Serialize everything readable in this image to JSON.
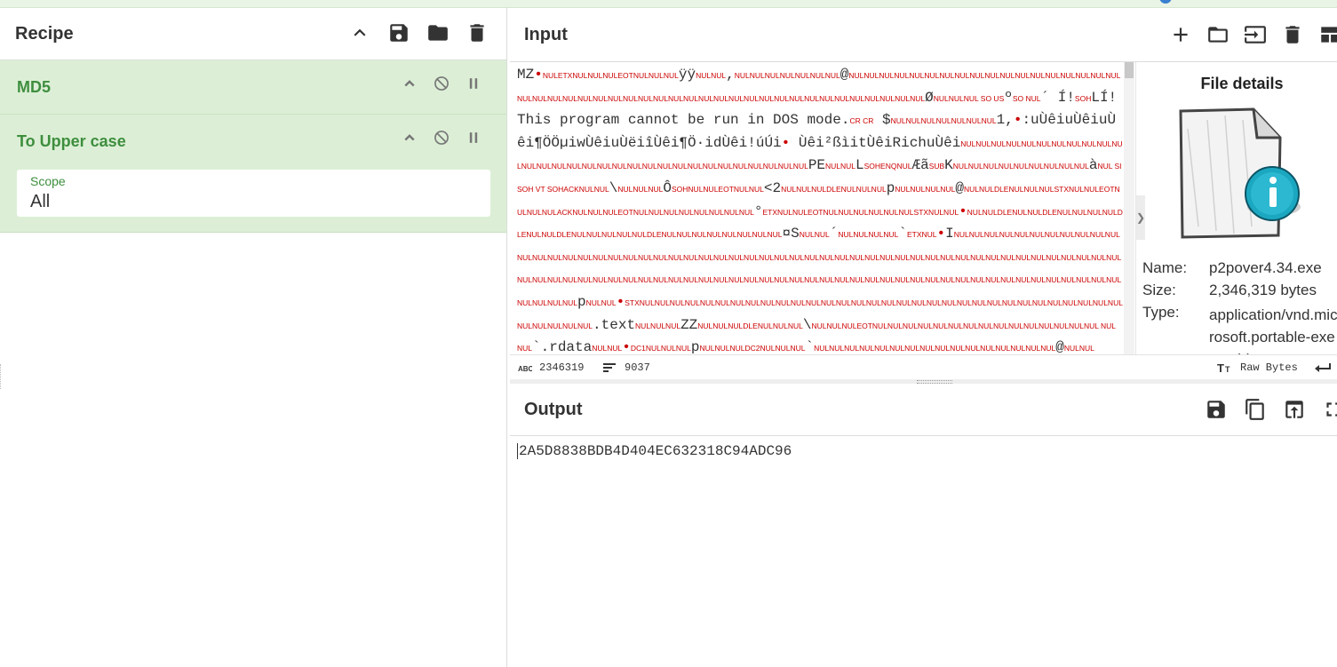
{
  "recipe": {
    "title": "Recipe",
    "operations": [
      {
        "name": "MD5"
      },
      {
        "name": "To Upper case",
        "scope_label": "Scope",
        "scope_value": "All"
      }
    ]
  },
  "input": {
    "title": "Input",
    "content_segments": [
      [
        "t",
        "MZ"
      ],
      [
        "d",
        "•"
      ],
      [
        "c",
        "NULETXNULNULNULEOTNULNULNUL"
      ],
      [
        "t",
        "ÿÿ"
      ],
      [
        "c",
        "NULNUL"
      ],
      [
        "t",
        ","
      ],
      [
        "c",
        "NULNULNULNULNULNULNUL"
      ],
      [
        "t",
        "@"
      ],
      [
        "c",
        "NULNULNULNULNULNULNULNULNULNULNULNULNULNULNULNULNULNULNULNULNULNULNULNULNULNULNULNULNULNULNULNULNULNULNULNULNULNULNULNULNULNULNULNULNUL"
      ],
      [
        "t",
        "Ø"
      ],
      [
        "c",
        "NULNULNUL SO US"
      ],
      [
        "t",
        "º"
      ],
      [
        "c",
        "SO NUL"
      ],
      [
        "t",
        "´   Í!"
      ],
      [
        "c",
        "SOH"
      ],
      [
        "t",
        "LÍ!This program cannot be run in DOS mode."
      ],
      [
        "c",
        "CR CR"
      ],
      [
        "t",
        " $"
      ],
      [
        "c",
        "NULNULNULNULNULNULNUL"
      ],
      [
        "t",
        "1,"
      ],
      [
        "d",
        "•"
      ],
      [
        "t",
        ":uÙêiuÙêiuÙêi¶ÖÖµiwÙêiuÙëiîÙêi¶Ö·idÙêi!úÚi"
      ],
      [
        "d",
        "•"
      ],
      [
        "t",
        " Ùêi²ßìitÙêiRichuÙêi"
      ],
      [
        "c",
        "NULNULNULNULNULNULNULNULNULNULNULNULNULNULNULNULNULNULNULNULNULNULNULNULNULNULNULNULNULNUL"
      ],
      [
        "t",
        "PE"
      ],
      [
        "c",
        "NULNUL"
      ],
      [
        "t",
        "L"
      ],
      [
        "c",
        "SOHENQNUL"
      ],
      [
        "t",
        "Æã"
      ],
      [
        "c",
        "SUB"
      ],
      [
        "t",
        "K"
      ],
      [
        "c",
        "NULNULNULNULNULNULNULNULNUL"
      ],
      [
        "t",
        "à"
      ],
      [
        "c",
        "NUL SI SOH VT SOHACKNULNUL"
      ],
      [
        "t",
        "\\"
      ],
      [
        "c",
        "NULNULNUL"
      ],
      [
        "t",
        "Ô"
      ],
      [
        "c",
        "SOHNULNULEOTNULNUL"
      ],
      [
        "t",
        "<2"
      ],
      [
        "c",
        "NULNULNULDLENULNULNUL"
      ],
      [
        "t",
        "p"
      ],
      [
        "c",
        "NULNULNULNUL"
      ],
      [
        "t",
        "@"
      ],
      [
        "c",
        "NULNULDLENULNULNULSTXNULNULEOTNULNULNULACKNULNULNULEOTNULNULNULNULNULNULNULNUL"
      ],
      [
        "t",
        "°"
      ],
      [
        "c",
        "ETXNULNULEOTNULNULNULNULNULNULSTXNULNUL"
      ],
      [
        "d",
        "•"
      ],
      [
        "c",
        "NULNULDLENULNULDLENULNULNULNULDLENULNULDLENULNULNULNULNULDLENULNULNULNULNULNULNULNUL"
      ],
      [
        "t",
        "¤S"
      ],
      [
        "c",
        "NULNUL"
      ],
      [
        "t",
        "´"
      ],
      [
        "c",
        "NULNULNULNUL"
      ],
      [
        "t",
        "`"
      ],
      [
        "c",
        "ETXNUL"
      ],
      [
        "d",
        "•"
      ],
      [
        "t",
        "I"
      ],
      [
        "c",
        "NULNULNULNULNULNULNULNULNULNULNULNULNULNULNULNULNULNULNULNULNULNULNULNULNULNULNULNULNULNULNULNULNULNULNULNULNULNULNULNULNULNULNULNULNULNULNULNULNULNULNULNULNULNULNULNULNULNULNULNULNULNULNULNULNULNULNULNULNULNULNULNULNULNULNULNULNULNULNULNULNULNULNULNULNULNULNULNULNULNULNULNULNULNULNUL"
      ],
      [
        "t",
        "p"
      ],
      [
        "c",
        "NULNUL"
      ],
      [
        "d",
        "•"
      ],
      [
        "c",
        "STXNULNULNULNULNULNULNULNULNULNULNULNULNULNULNULNULNULNULNULNULNULNULNULNULNULNULNULNULNULNULNULNULNULNULNULNULNUL"
      ],
      [
        "t",
        ".text"
      ],
      [
        "c",
        "NULNULNUL"
      ],
      [
        "t",
        "ZZ"
      ],
      [
        "c",
        "NULNULNULDLENULNULNUL"
      ],
      [
        "t",
        "\\"
      ],
      [
        "c",
        "NULNULNULEOTNULNULNULNULNULNULNULNULNULNULNULNULNULNULNUL NUL NUL"
      ],
      [
        "t",
        "`.rdata"
      ],
      [
        "c",
        "NULNUL"
      ],
      [
        "d",
        "•"
      ],
      [
        "c",
        "DC1NULNULNUL"
      ],
      [
        "t",
        "p"
      ],
      [
        "c",
        "NULNULNULDC2NULNULNUL"
      ],
      [
        "t",
        "`"
      ],
      [
        "c",
        "NULNULNULNULNULNULNULNULNULNULNULNULNULNULNULNUL"
      ],
      [
        "t",
        "@"
      ],
      [
        "c",
        "NULNUL"
      ]
    ],
    "status": {
      "length": "2346319",
      "lines": "9037",
      "encoding": "Raw Bytes"
    },
    "file_details": {
      "title": "File details",
      "name_label": "Name:",
      "name_value": "p2pover4.34.exe",
      "size_label": "Size:",
      "size_value": "2,346,319 bytes",
      "type_label": "Type:",
      "type_value": "application/vnd.microsoft.portable-executable"
    }
  },
  "output": {
    "title": "Output",
    "content": "2A5D8838BDB4D404EC632318C94ADC96"
  }
}
